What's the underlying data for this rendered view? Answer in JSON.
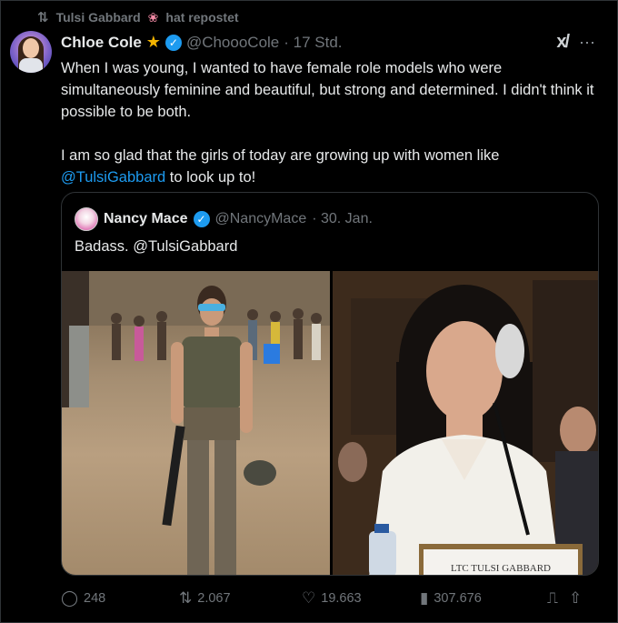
{
  "repost": {
    "icon": "repost-icon",
    "user": "Tulsi Gabbard",
    "label": "hat repostet"
  },
  "tweet": {
    "author_name": "Chloe Cole",
    "author_handle": "@ChoooCole",
    "time": "· 17 Std.",
    "text_line1": "When I was young, I wanted to have female role models who were simultaneously feminine and beautiful, but strong and determined. I didn't think it possible to be both.",
    "text_line2_pre": "I am so glad that the girls of today are growing up with women like ",
    "text_line2_mention": "@TulsiGabbard",
    "text_line2_post": " to look up to!"
  },
  "quote": {
    "author_name": "Nancy Mace",
    "author_handle": "@NancyMace",
    "time": "· 30. Jan.",
    "text": "Badass. @TulsiGabbard"
  },
  "stats": {
    "replies": "248",
    "reposts": "2.067",
    "likes": "19.663",
    "views": "307.676"
  },
  "top_right": {
    "grok": "x/",
    "more": "···"
  },
  "nameplate": "LTC TULSI GABBARD",
  "colors": {
    "accent": "#1d9bf0",
    "muted": "#71767b",
    "background": "#000000"
  }
}
